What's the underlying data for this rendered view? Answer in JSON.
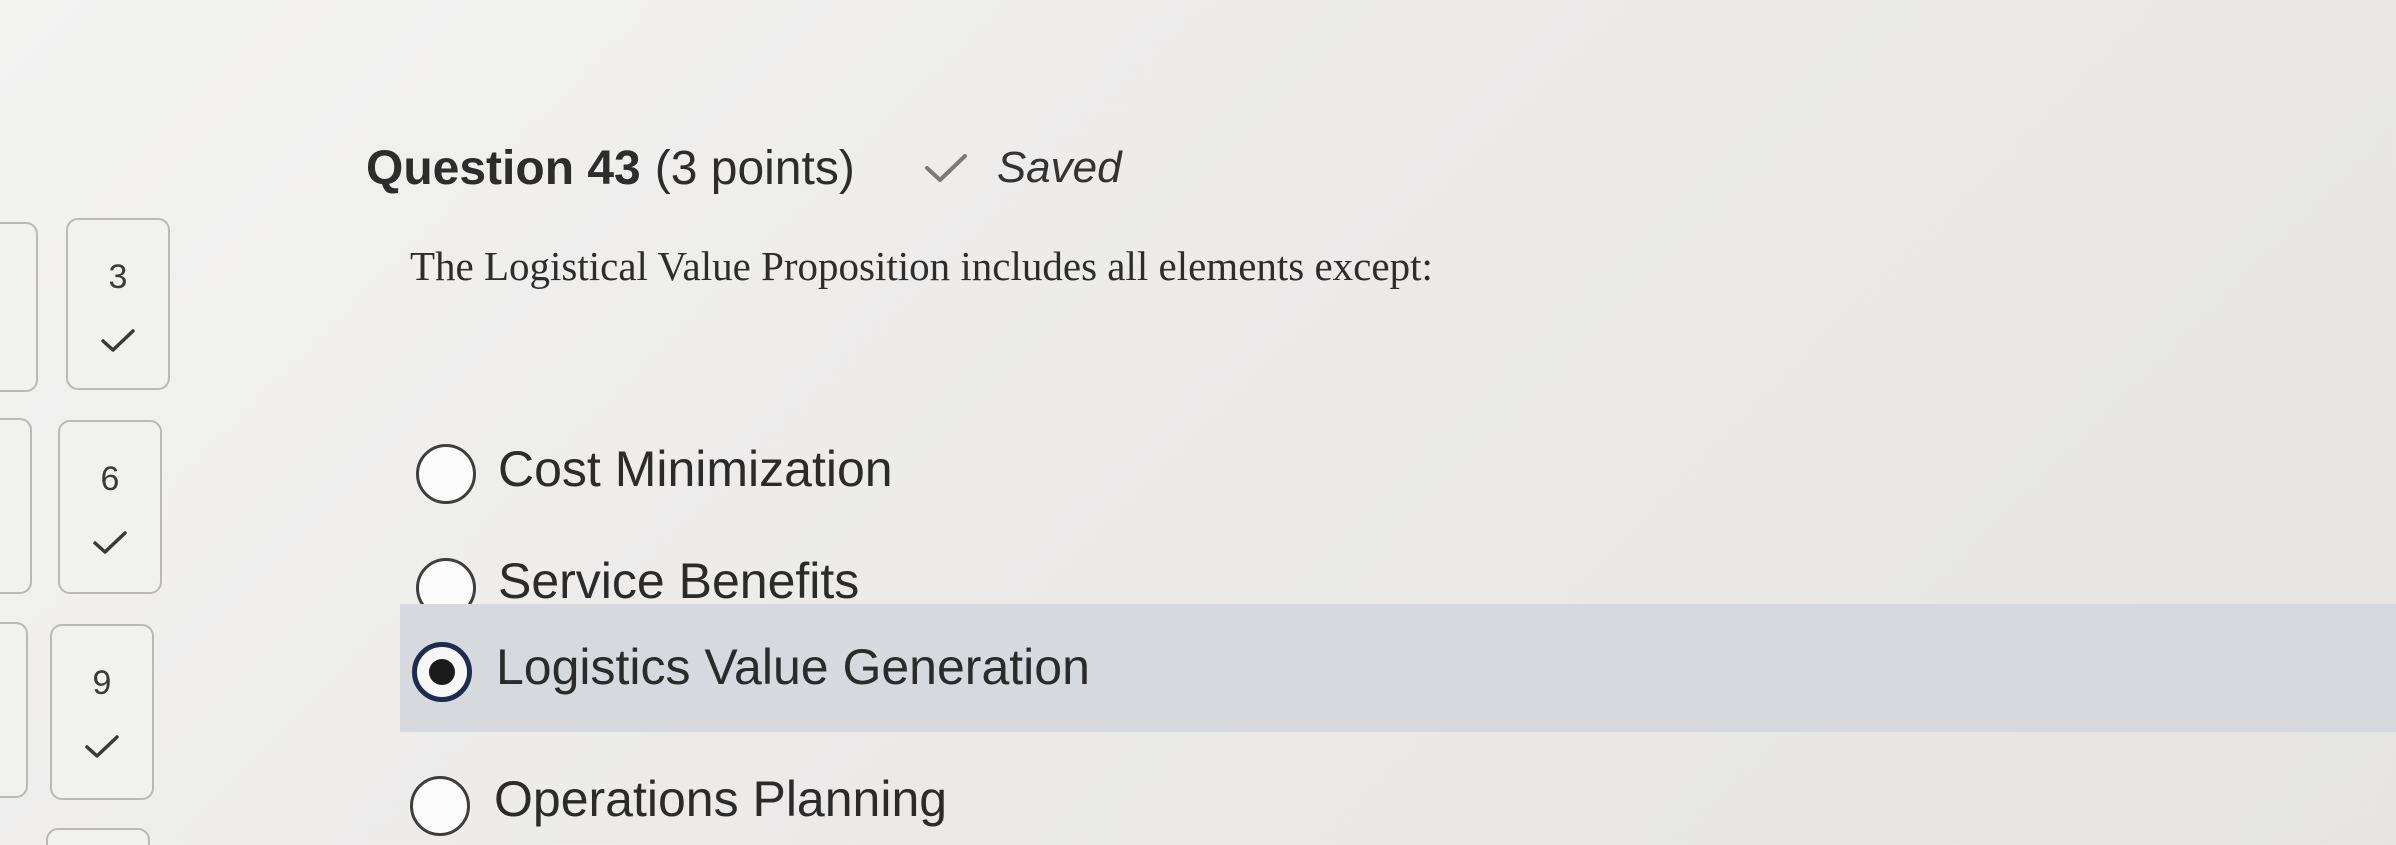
{
  "question": {
    "title": "Question 43",
    "points": "(3 points)",
    "status_icon": "checkmark-icon",
    "status": "Saved",
    "prompt": "The Logistical Value Proposition includes all elements except:"
  },
  "navigator": {
    "tiles": [
      {
        "number": "3",
        "answered": true,
        "icon": "checkmark-icon"
      },
      {
        "number": "6",
        "answered": true,
        "icon": "checkmark-icon"
      },
      {
        "number": "9",
        "answered": true,
        "icon": "checkmark-icon"
      }
    ]
  },
  "options": [
    {
      "label": "Cost Minimization",
      "selected": false
    },
    {
      "label": "Service Benefits",
      "selected": false
    },
    {
      "label": "Logistics Value Generation",
      "selected": true
    },
    {
      "label": "Operations Planning",
      "selected": false
    }
  ],
  "colors": {
    "selected_row": "#d6d9dd",
    "radio_selected_ring": "#1e2d4f",
    "text": "#2d2d2d"
  }
}
